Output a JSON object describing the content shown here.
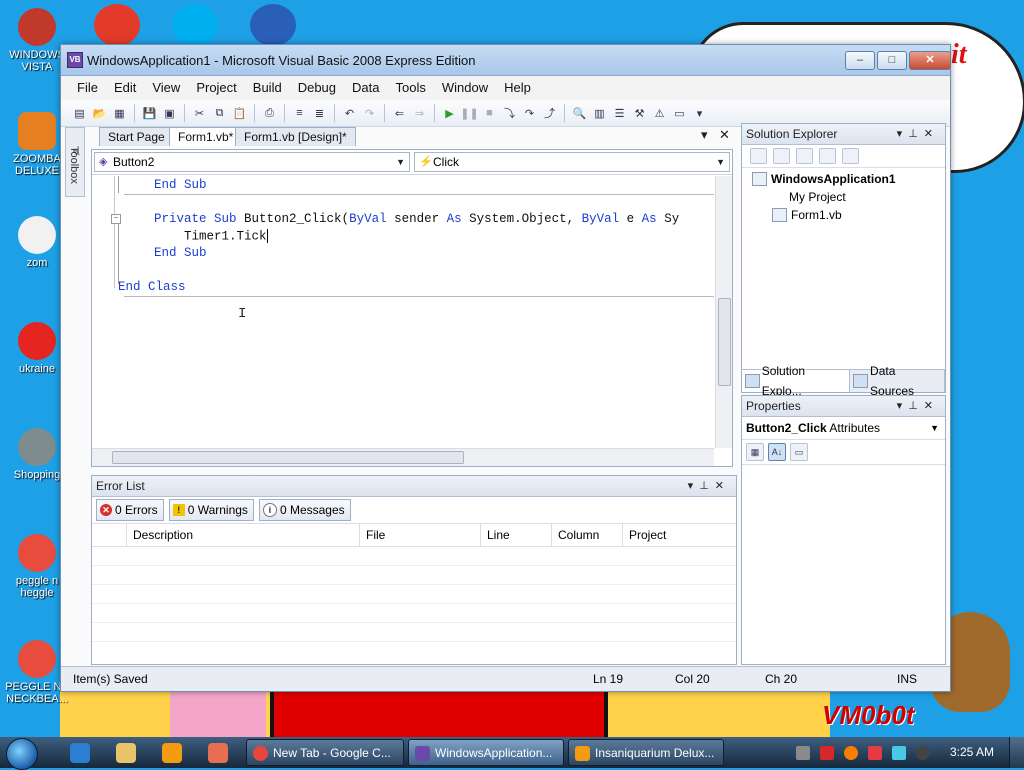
{
  "desktop": {
    "icons": [
      {
        "label": "WINDOWS VISTA"
      },
      {
        "label": "ZOOMBA DELUXE"
      },
      {
        "label": "zom"
      },
      {
        "label": "ukraine"
      },
      {
        "label": "Shopping"
      },
      {
        "label": "peggle n heggle"
      },
      {
        "label": "PEGGLE NE NECKBEA..."
      }
    ],
    "wallpaper_text": "VM0b0t",
    "cloud_text": "it"
  },
  "window": {
    "title": "WindowsApplication1 - Microsoft Visual Basic 2008 Express Edition",
    "icon_text": "VB",
    "controls": {
      "minimize": "–",
      "maximize": "□",
      "close": "✕"
    }
  },
  "menu": [
    "File",
    "Edit",
    "View",
    "Project",
    "Build",
    "Debug",
    "Data",
    "Tools",
    "Window",
    "Help"
  ],
  "toolbox": {
    "label": "Toolbox"
  },
  "doc_tabs": [
    {
      "label": "Start Page"
    },
    {
      "label": "Form1.vb*"
    },
    {
      "label": "Form1.vb [Design]*"
    }
  ],
  "doc_tab_controls": {
    "dropdown": "▾",
    "close": "✕"
  },
  "editor": {
    "object_combo": "Button2",
    "event_combo": "Click",
    "lines": [
      {
        "indent": "    ",
        "parts": [
          {
            "t": "End Sub",
            "kw": true
          }
        ]
      },
      {
        "indent": "",
        "parts": []
      },
      {
        "indent": "    ",
        "parts": [
          {
            "t": "Private Sub",
            "kw": true
          },
          {
            "t": " Button2_Click(",
            "kw": false
          },
          {
            "t": "ByVal",
            "kw": true
          },
          {
            "t": " sender ",
            "kw": false
          },
          {
            "t": "As",
            "kw": true
          },
          {
            "t": " System.Object, ",
            "kw": false
          },
          {
            "t": "ByVal",
            "kw": true
          },
          {
            "t": " e ",
            "kw": false
          },
          {
            "t": "As",
            "kw": true
          },
          {
            "t": " Sy",
            "kw": false
          }
        ]
      },
      {
        "indent": "        ",
        "parts": [
          {
            "t": "Timer1.Tick",
            "kw": false
          }
        ]
      },
      {
        "indent": "    ",
        "parts": [
          {
            "t": "End Sub",
            "kw": true
          }
        ]
      },
      {
        "indent": "",
        "parts": []
      },
      {
        "indent": "",
        "parts": [
          {
            "t": "End Class",
            "kw": true
          }
        ]
      }
    ]
  },
  "error_list": {
    "title": "Error List",
    "errors_label": "0 Errors",
    "warnings_label": "0 Warnings",
    "messages_label": "0 Messages",
    "columns": [
      "",
      "Description",
      "File",
      "Line",
      "Column",
      "Project"
    ]
  },
  "solution_explorer": {
    "title": "Solution Explorer",
    "project": "WindowsApplication1",
    "items": [
      "My Project",
      "Form1.vb"
    ],
    "tabs": [
      "Solution Explo...",
      "Data Sources"
    ]
  },
  "properties": {
    "title": "Properties",
    "object_name": "Button2_Click",
    "object_type": "Attributes"
  },
  "status": {
    "message": "Item(s) Saved",
    "ln": "Ln 19",
    "col": "Col 20",
    "ch": "Ch 20",
    "mode": "INS"
  },
  "taskbar": {
    "tasks": [
      {
        "label": "New Tab - Google C...",
        "color": "#e8453c"
      },
      {
        "label": "WindowsApplication...",
        "color": "#6a4aa8"
      },
      {
        "label": "Insaniquarium Delux...",
        "color": "#f39c12"
      }
    ],
    "clock": "3:25 AM"
  },
  "colors": {
    "desktop": "#1ea0e6",
    "keyword": "#1a3fcf",
    "title_gradient": "#a9c7ea"
  }
}
